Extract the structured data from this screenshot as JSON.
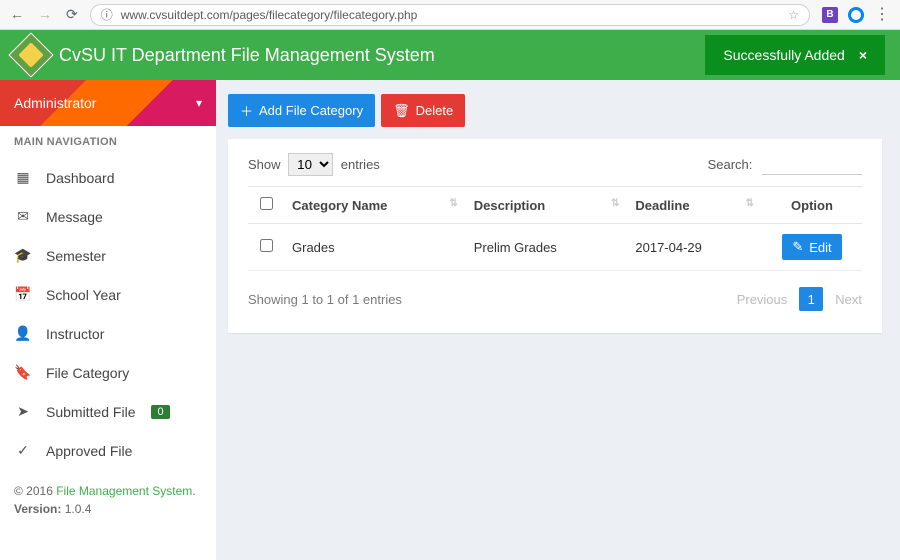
{
  "browser": {
    "url": "www.cvsuitdept.com/pages/filecategory/filecategory.php"
  },
  "app": {
    "title": "CvSU IT Department File Management System"
  },
  "toast": {
    "message": "Successfully Added",
    "close_glyph": "×"
  },
  "sidebar": {
    "user_label": "Administrator",
    "nav_header": "MAIN NAVIGATION",
    "items": [
      {
        "icon": "▦",
        "label": "Dashboard"
      },
      {
        "icon": "✉",
        "label": "Message"
      },
      {
        "icon": "🎓",
        "label": "Semester"
      },
      {
        "icon": "📅",
        "label": "School Year"
      },
      {
        "icon": "👤",
        "label": "Instructor"
      },
      {
        "icon": "🔖",
        "label": "File Category"
      },
      {
        "icon": "➤",
        "label": "Submitted File",
        "badge": "0"
      },
      {
        "icon": "✓",
        "label": "Approved File"
      }
    ],
    "footer": {
      "prefix": "© 2016 ",
      "link": "File Management System",
      "suffix": ".",
      "version_label": "Version:",
      "version_value": "1.0.4"
    }
  },
  "actions": {
    "add_label": "Add File Category",
    "delete_label": "Delete"
  },
  "table": {
    "show_label": "Show",
    "per_page": "10",
    "entries_label": "entries",
    "search_label": "Search:",
    "columns": {
      "category": "Category Name",
      "description": "Description",
      "deadline": "Deadline",
      "option": "Option"
    },
    "rows": [
      {
        "category": "Grades",
        "description": "Prelim Grades",
        "deadline": "2017-04-29",
        "edit_label": "Edit"
      }
    ],
    "info": "Showing 1 to 1 of 1 entries",
    "pager": {
      "prev": "Previous",
      "page": "1",
      "next": "Next"
    }
  }
}
